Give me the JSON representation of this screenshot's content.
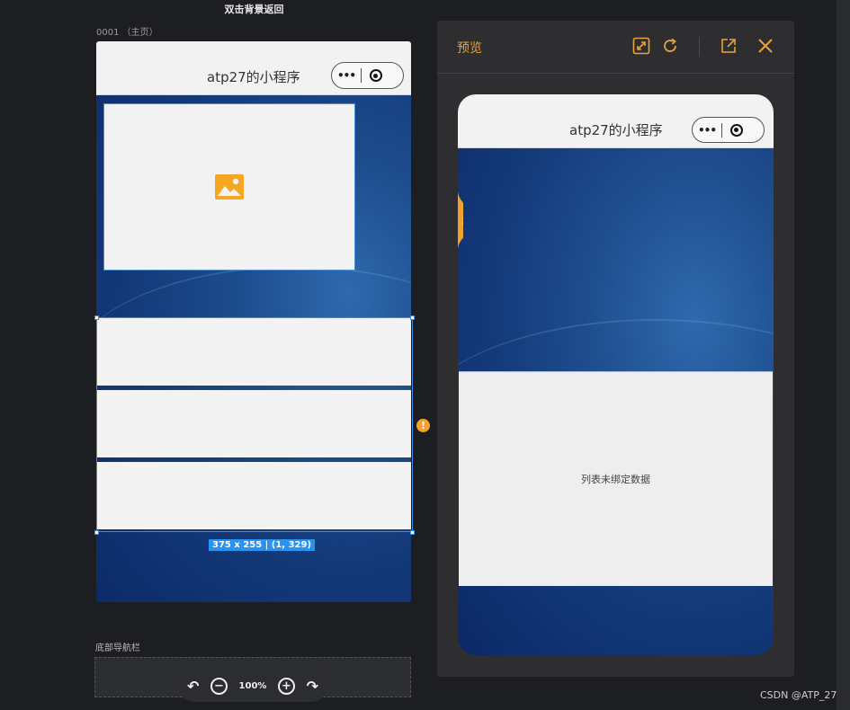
{
  "hint": "双击背景返回",
  "page": {
    "label": "0001 （主页）"
  },
  "editor": {
    "nav_title": "atp27的小程序",
    "capsule_dots": "•••",
    "selection_badge": "375 x 255 | (1, 329)",
    "warning_glyph": "!"
  },
  "tabbar": {
    "label": "底部导航栏"
  },
  "zoom": {
    "level": "100%",
    "undo_glyph": "↶",
    "redo_glyph": "↷",
    "minus_glyph": "−",
    "plus_glyph": "+"
  },
  "preview": {
    "title": "预览",
    "nav_title": "atp27的小程序",
    "capsule_dots": "•••",
    "empty_list_text": "列表未绑定数据",
    "side_tab_glyph": "Z"
  },
  "watermark": "CSDN @ATP_27",
  "colors": {
    "accent": "#e8a23a",
    "selection": "#3b8fe0",
    "image_icon": "#f5a623"
  }
}
